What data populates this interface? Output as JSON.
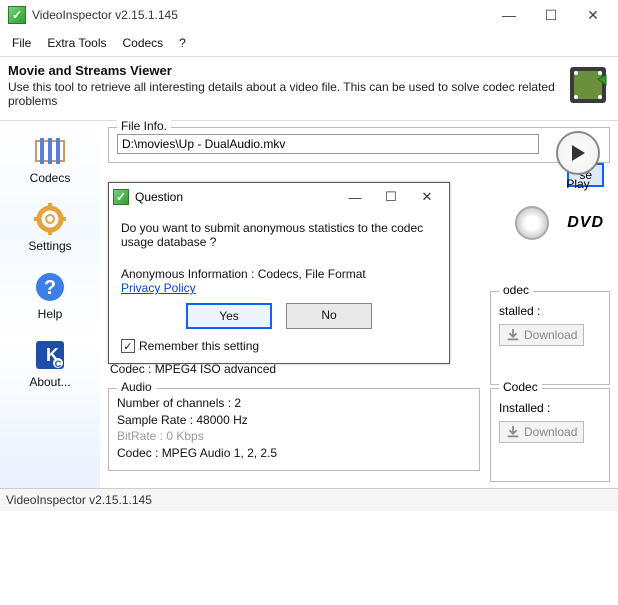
{
  "window": {
    "title": "VideoInspector v2.15.1.145",
    "minimize": "—",
    "maximize": "☐",
    "close": "✕"
  },
  "menu": {
    "file": "File",
    "extra": "Extra Tools",
    "codecs": "Codecs",
    "help": "?"
  },
  "header": {
    "title": "Movie and Streams Viewer",
    "desc": "Use this tool to retrieve all interesting details about a video file. This can be used to solve codec related problems"
  },
  "sidebar": {
    "codecs": "Codecs",
    "settings": "Settings",
    "help": "Help",
    "about": "About..."
  },
  "fileinfo": {
    "legend": "File Info.",
    "path": "D:\\movies\\Up - DualAudio.mkv",
    "browse": "se"
  },
  "play": "Play",
  "dvd": "DVD",
  "video": {
    "codec_line": "Codec : MPEG4 ISO advanced"
  },
  "audio": {
    "legend": "Audio",
    "channels": "Number of channels : 2",
    "sample": "Sample Rate : 48000 Hz",
    "bitrate": "BitRate : 0 Kbps",
    "codec": "Codec : MPEG Audio 1, 2, 2.5"
  },
  "codec_panel": {
    "legend_top": "odec",
    "legend_bottom": "Codec",
    "status_top": "stalled :",
    "status_bottom": "Installed :",
    "download": "Download"
  },
  "modal": {
    "title": "Question",
    "body": "Do you want to submit anonymous statistics to the codec usage database ?",
    "info": "Anonymous Information : Codecs, File Format",
    "privacy": "Privacy Policy",
    "yes": "Yes",
    "no": "No",
    "remember": "Remember this setting",
    "checked": "✓"
  },
  "status": "VideoInspector v2.15.1.145"
}
